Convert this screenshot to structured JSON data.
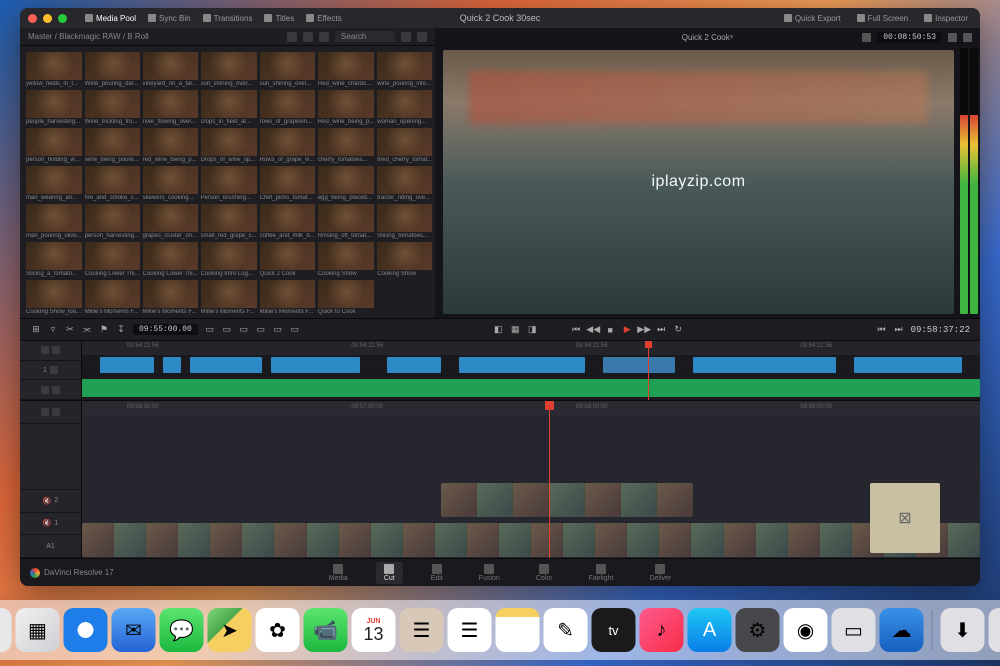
{
  "titlebar": {
    "project_title": "Quick 2 Cook 30sec",
    "tabs": {
      "media_pool": "Media Pool",
      "sync_bin": "Sync Bin",
      "transitions": "Transitions",
      "titles": "Titles",
      "effects": "Effects"
    },
    "right": {
      "quick_export": "Quick Export",
      "full_screen": "Full Screen",
      "inspector": "Inspector"
    }
  },
  "media_pool": {
    "breadcrumb": "Master / Blackmagic RAW / B Roll",
    "search_placeholder": "Search",
    "clips": [
      "yellow_fields_in_t...",
      "Wine_pouring_dar...",
      "vineyard_on_a_far...",
      "sun_shining_over...",
      "sun_shining_over...",
      "Red_wine_chardo...",
      "wine_pouring_into...",
      "people_harvesting...",
      "Wine_trickling_fro...",
      "river_flowing_over...",
      "crops_in_field_at...",
      "rows_of_grapevin...",
      "Red_wine_being_p...",
      "woman_opening...",
      "person_holding_w...",
      "wine_being_poure...",
      "red_wine_being_p...",
      "Drops_of_wine_sp...",
      "Rows_of_grape_vi...",
      "cherry_tomatoes...",
      "fried_cherry_tomat...",
      "man_wearing_an...",
      "fire_and_smoke_c...",
      "skewers_cooking...",
      "Person_brushing...",
      "Chef_picks_tomat...",
      "egg_being_placed...",
      "tractor_riding_ove...",
      "man_pouring_olive...",
      "person_harvesting...",
      "grapes_cluster_on...",
      "small_red_grape_c...",
      "coffee_and_milk_b...",
      "Rinsing_off_tomat...",
      "Slicing_tomatoes...",
      "Slicing_a_tomato...",
      "Cooking Lower Thi...",
      "Cooking Lower Thi...",
      "Cooking Intro Log...",
      "Quick 2 Cook",
      "Cooking Show",
      "Cooking Show",
      "Cooking Show_loo...",
      "Millie's Moments F...",
      "Millie's Moments F...",
      "Millie's Moments F...",
      "Millie's Moments F...",
      "Quick to Cook"
    ]
  },
  "viewer": {
    "clip_name": "Quick 2 Cook",
    "source_tc": "00:08:50:53",
    "watermark": "iplayzip.com"
  },
  "transport": {
    "left_tc": "09:55:00.00",
    "right_tc": "09:58:37:22",
    "ticks": [
      "09:54:22.56",
      "09:54:22.56",
      "09:54:22.56",
      "09:54:22.56"
    ]
  },
  "timeline": {
    "ruler": [
      "09:56:00:00",
      "09:57:00:00",
      "09:58:00:00",
      "09:59:00:00"
    ],
    "track_v1": "1",
    "track_v2": "2",
    "track_a1": "A1"
  },
  "pages": {
    "media": "Media",
    "cut": "Cut",
    "edit": "Edit",
    "fusion": "Fusion",
    "color": "Color",
    "fairlight": "Fairlight",
    "deliver": "Deliver",
    "app_name": "DaVinci Resolve 17"
  },
  "dock": {
    "calendar_month": "JUN",
    "calendar_day": "13",
    "icons": [
      "finder",
      "launchpad",
      "safari",
      "mail",
      "messages",
      "maps",
      "photos",
      "facetime",
      "calendar",
      "contacts",
      "reminders",
      "notes",
      "freeform",
      "tv",
      "music",
      "appstore",
      "system-settings",
      "chrome",
      "app1",
      "weather",
      "downloads",
      "trash"
    ]
  }
}
